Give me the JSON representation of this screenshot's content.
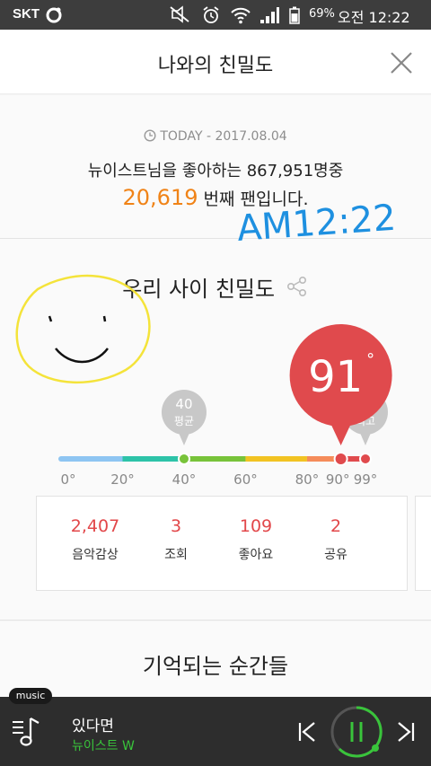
{
  "status_bar": {
    "carrier": "SKT",
    "battery": "69%",
    "time": "오전 12:22",
    "icons": [
      "signal-off-icon",
      "alarm-icon",
      "wifi-icon",
      "cell-signal-icon",
      "battery-icon"
    ]
  },
  "header": {
    "title": "나와의 친밀도",
    "close_icon": "close-icon"
  },
  "today": {
    "label": "TODAY",
    "date": "2017.08.04",
    "fans_line": "뉴이스트님을 좋아하는 867,951명중",
    "rank": "20,619",
    "rank_suffix": "번째 팬입니다."
  },
  "intimacy": {
    "title": "우리 사이 친밀도",
    "score": "91",
    "score_unit": "°",
    "average": {
      "value": "40",
      "label": "평균"
    },
    "max": {
      "value": "99",
      "label": "최고"
    },
    "scale_ticks": [
      "0°",
      "20°",
      "40°",
      "60°",
      "80°",
      "90°",
      "99°"
    ],
    "scale_max": 99,
    "stats": [
      {
        "value": "2,407",
        "label": "음악감상"
      },
      {
        "value": "3",
        "label": "조회"
      },
      {
        "value": "109",
        "label": "좋아요"
      },
      {
        "value": "2",
        "label": "공유"
      }
    ],
    "colors": {
      "score_bubble": "#e04a4d",
      "marker_bubble": "#c8c8c8",
      "segments": [
        "#8ec5f2",
        "#2dc3a8",
        "#78c33a",
        "#f2c322",
        "#f58c5a",
        "#e04a4d"
      ]
    }
  },
  "moments": {
    "title": "기억되는 순간들"
  },
  "player": {
    "tag": "music",
    "song": "있다면",
    "artist": "뉴이스트 W",
    "accent": "#39c43b"
  },
  "annotations": {
    "handwritten_time": "AM12:22"
  }
}
